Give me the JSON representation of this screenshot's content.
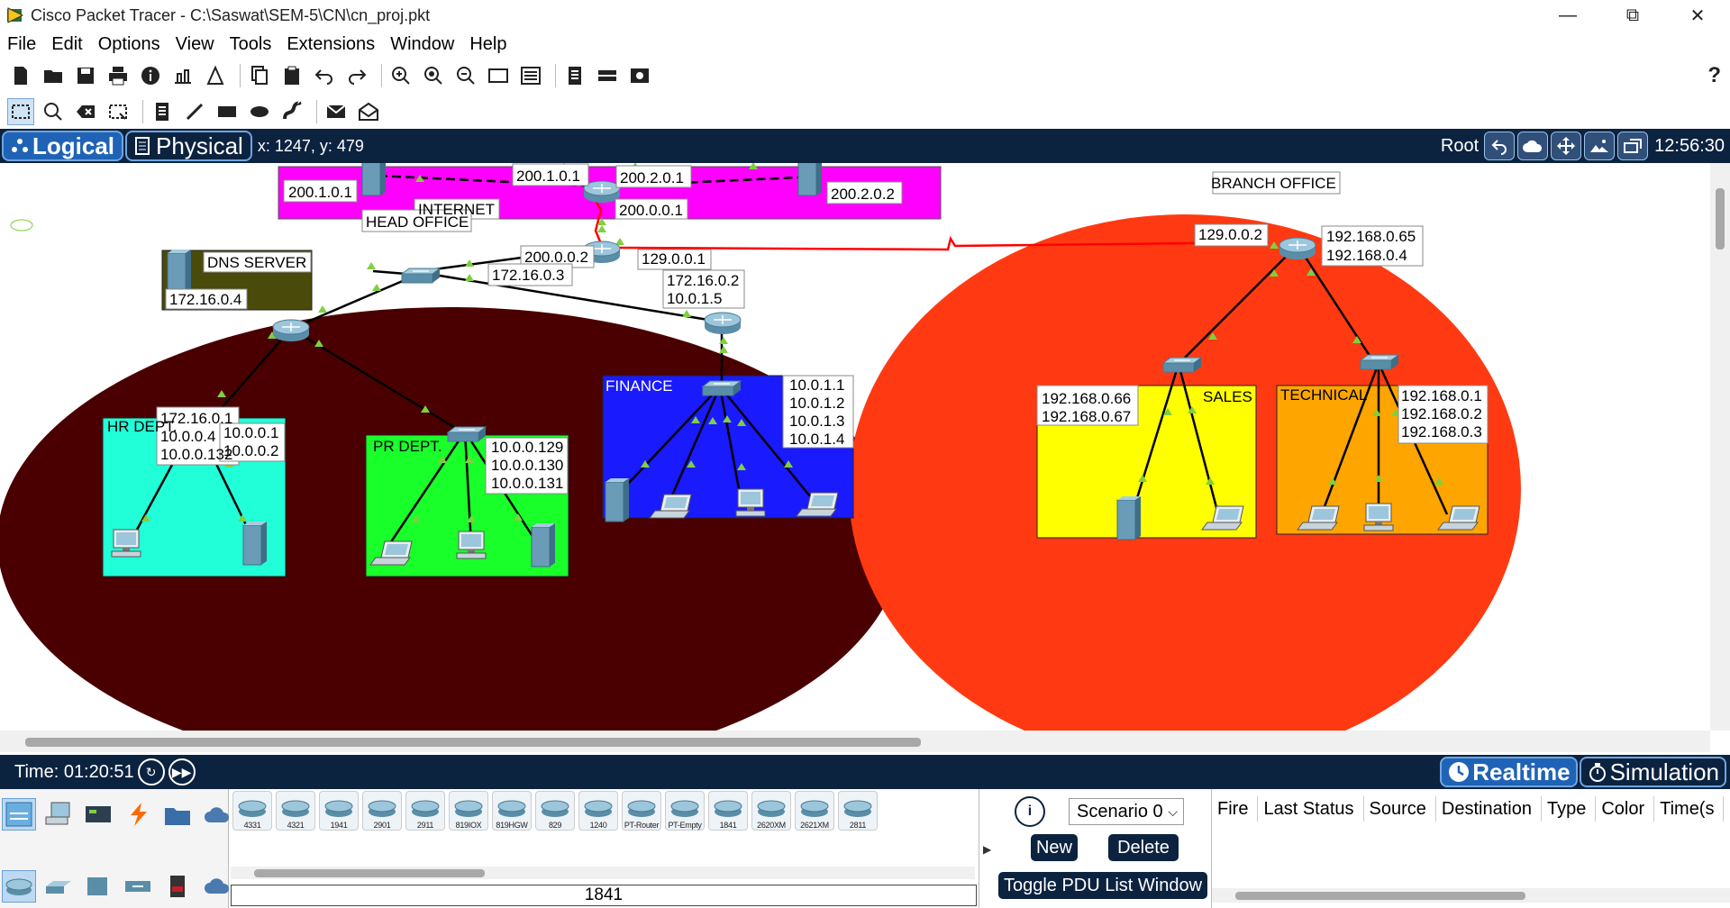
{
  "window": {
    "title": "Cisco Packet Tracer - C:\\Saswat\\SEM-5\\CN\\cn_proj.pkt",
    "minimize": "—",
    "maximize": "⧉",
    "close": "✕"
  },
  "menu": [
    "File",
    "Edit",
    "Options",
    "View",
    "Tools",
    "Extensions",
    "Window",
    "Help"
  ],
  "help_label": "?",
  "workspace": {
    "logical_label": "Logical",
    "physical_label": "Physical",
    "coords": "x: 1247, y: 479",
    "root_label": "Root",
    "clock": "12:56:30"
  },
  "topology": {
    "zones": {
      "internet": "INTERNET",
      "head_office": "HEAD OFFICE",
      "branch_office": "BRANCH OFFICE",
      "dns": "DNS SERVER",
      "hr": "HR DEPT.",
      "pr": "PR DEPT.",
      "finance": "FINANCE",
      "sales": "SALES",
      "technical": "TECHNICAL"
    },
    "labels": {
      "inet_left_server": "200.1.0.1",
      "inet_router_left": "200.1.0.1",
      "inet_router_right": "200.2.0.1",
      "inet_router_down": "200.0.0.1",
      "inet_right_server": "200.2.0.2",
      "ho_router_wan": "200.0.0.2",
      "ho_router_branch": "129.0.0.1",
      "ho_router_lan": "172.16.0.3",
      "dns_ip": "172.16.0.4",
      "fin_router_1": "172.16.0.2",
      "fin_router_2": "10.0.1.5",
      "core_router_1": "172.16.0.1",
      "core_router_2": "10.0.0.4",
      "core_router_3": "10.0.0.132",
      "hr_1": "10.0.0.1",
      "hr_2": "10.0.0.2",
      "pr_1": "10.0.0.129",
      "pr_2": "10.0.0.130",
      "pr_3": "10.0.0.131",
      "fin_1": "10.0.1.1",
      "fin_2": "10.0.1.2",
      "fin_3": "10.0.1.3",
      "fin_4": "10.0.1.4",
      "br_router_wan": "129.0.0.2",
      "br_router_1": "192.168.0.65",
      "br_router_2": "192.168.0.4",
      "sales_1": "192.168.0.66",
      "sales_2": "192.168.0.67",
      "tech_1": "192.168.0.1",
      "tech_2": "192.168.0.2",
      "tech_3": "192.168.0.3"
    },
    "colors": {
      "internet": "#ff00ff",
      "head_office": "#4a0000",
      "branch_office": "#ff3a12",
      "dns": "#4a4a0a",
      "hr": "#21ffd9",
      "pr": "#19ff2a",
      "finance": "#1a1aff",
      "sales": "#ffff00",
      "technical": "#ffa500",
      "serial_link": "#ff0000",
      "link_marker": "#7fd040"
    }
  },
  "statusbar": {
    "time": "Time: 01:20:51",
    "realtime_label": "Realtime",
    "simulation_label": "Simulation"
  },
  "devices": {
    "models": [
      "4331",
      "4321",
      "1941",
      "2901",
      "2911",
      "819IOX",
      "819HGW",
      "829",
      "1240",
      "PT-Router",
      "PT-Empty",
      "1841",
      "2620XM",
      "2621XM",
      "2811"
    ],
    "selected_name": "1841"
  },
  "scenario": {
    "info_label": "i",
    "selected": "Scenario 0",
    "new_label": "New",
    "delete_label": "Delete",
    "toggle_label": "Toggle PDU List Window"
  },
  "pdu_columns": [
    "Fire",
    "Last Status",
    "Source",
    "Destination",
    "Type",
    "Color",
    "Time(s"
  ]
}
